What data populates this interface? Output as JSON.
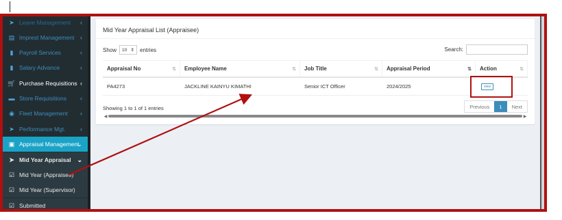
{
  "sidebar": {
    "items": [
      {
        "label": "Leave Management",
        "icon": "paper-plane-icon"
      },
      {
        "label": "Imprest Management",
        "icon": "money-icon"
      },
      {
        "label": "Payroll Services",
        "icon": "file-icon"
      },
      {
        "label": "Salary Advance",
        "icon": "file-icon"
      },
      {
        "label": "Purchase Requisitions",
        "icon": "cart-icon"
      },
      {
        "label": "Store Requisitions",
        "icon": "store-icon"
      },
      {
        "label": "Fleet Management",
        "icon": "car-icon"
      },
      {
        "label": "Performance Mgt.",
        "icon": "paper-plane-icon"
      },
      {
        "label": "Appraisal Management",
        "icon": "clipboard-icon"
      },
      {
        "label": "Mid Year Appraisal",
        "icon": "paper-plane-icon"
      },
      {
        "label": "Mid Year (Appraisee)",
        "icon": "clipboard-check-icon"
      },
      {
        "label": "Mid Year (Supervisor)",
        "icon": "clipboard-check-icon"
      },
      {
        "label": "Submitted",
        "icon": "clipboard-check-icon"
      }
    ]
  },
  "card": {
    "title": "Mid Year Appraisal List (Appraisee)",
    "show_label": "Show",
    "show_value": "10",
    "entries_label": "entries",
    "search_label": "Search:",
    "search_value": ""
  },
  "table": {
    "headers": [
      "Appraisal No",
      "Employee Name",
      "Job Title",
      "Appraisal Period",
      "Action"
    ],
    "rows": [
      {
        "appraisal_no": "PA4273",
        "employee_name": "JACKLINE KAINYU KIMATHI",
        "job_title": "Senior ICT Officer",
        "period": "2024/2025",
        "action": "view"
      }
    ]
  },
  "footer": {
    "info": "Showing 1 to 1 of 1 entries",
    "previous": "Previous",
    "page": "1",
    "next": "Next"
  },
  "colors": {
    "annotation": "#b01010",
    "sidebar_bg": "#222d32",
    "active": "#1aa3c7",
    "link": "#3c8dbc"
  }
}
